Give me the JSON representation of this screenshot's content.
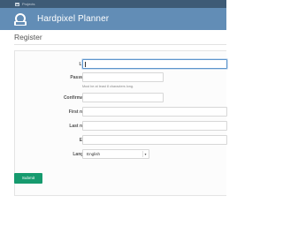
{
  "top_menu": {
    "projects_label": "Projects"
  },
  "header": {
    "app_title": "Hardpixel Planner"
  },
  "page": {
    "title": "Register"
  },
  "form": {
    "login_label": "Login",
    "login_value": "",
    "password_label": "Password",
    "password_hint": "Must be at least 8 characters long.",
    "confirmation_label": "Confirmation",
    "first_name_label": "First name",
    "last_name_label": "Last name",
    "email_label": "Email",
    "language_label": "Language",
    "language_value": "English",
    "required_marker": "*",
    "submit_label": "Submit"
  },
  "colors": {
    "top_menu_bg": "#3e5b76",
    "header_bg": "#628db6",
    "submit_bg": "#169a6e",
    "required": "#bb0000",
    "focus_border": "#5d95cc"
  },
  "icons": {
    "home": "home-icon",
    "logo": "app-logo",
    "select": "chevron-down-icon"
  }
}
